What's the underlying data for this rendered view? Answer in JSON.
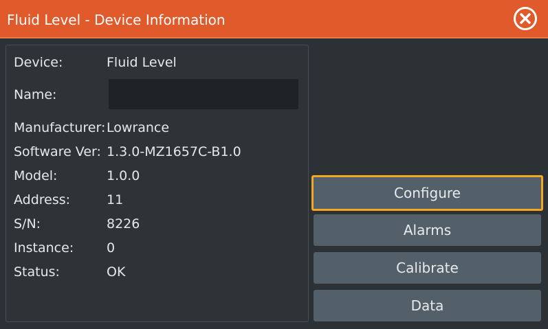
{
  "window": {
    "title": "Fluid Level - Device Information",
    "close_icon": "close-circle-icon"
  },
  "device_info": {
    "device": {
      "label": "Device:",
      "value": "Fluid Level"
    },
    "name": {
      "label": "Name:",
      "value": "",
      "placeholder": ""
    },
    "manufacturer": {
      "label": "Manufacturer:",
      "value": "Lowrance"
    },
    "software_ver": {
      "label": "Software Ver:",
      "value": "1.3.0-MZ1657C-B1.0"
    },
    "model": {
      "label": "Model:",
      "value": "1.0.0"
    },
    "address": {
      "label": "Address:",
      "value": "11"
    },
    "serial": {
      "label": "S/N:",
      "value": "8226"
    },
    "instance": {
      "label": "Instance:",
      "value": "0"
    },
    "status": {
      "label": "Status:",
      "value": "OK"
    }
  },
  "actions": {
    "configure": "Configure",
    "alarms": "Alarms",
    "calibrate": "Calibrate",
    "data": "Data",
    "selected": "configure"
  },
  "colors": {
    "titlebar": "#e05a2b",
    "background": "#2c3136",
    "button": "#535f69",
    "focus_outline": "#f5a623"
  }
}
